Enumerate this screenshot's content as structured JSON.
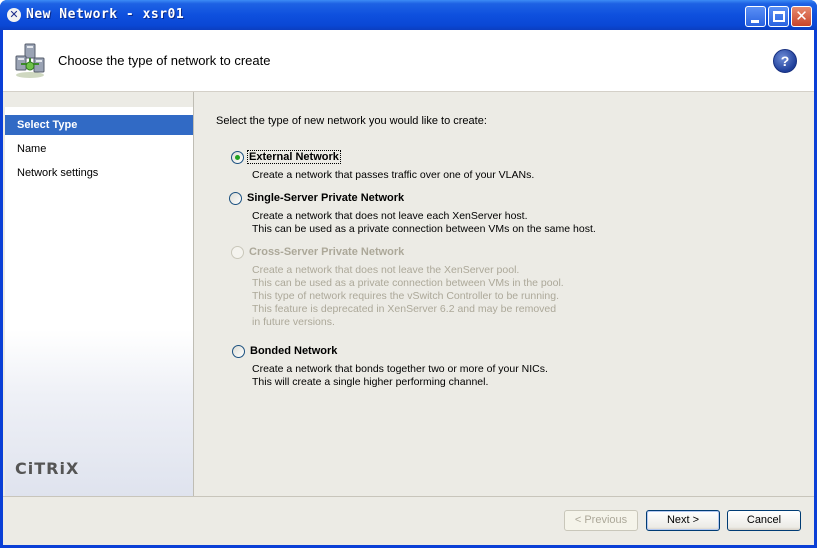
{
  "window": {
    "title": "New Network - xsr01",
    "title_icon": "x-app-icon"
  },
  "header": {
    "title": "Choose the type of network to create",
    "help_glyph": "?"
  },
  "nav": {
    "items": [
      {
        "label": "Select Type",
        "selected": true
      },
      {
        "label": "Name",
        "selected": false
      },
      {
        "label": "Network settings",
        "selected": false
      }
    ],
    "logo": "CiTRiX"
  },
  "main": {
    "prompt": "Select the type of new network you would like to create:",
    "options": [
      {
        "label": "External Network",
        "checked": true,
        "enabled": true,
        "description": [
          "Create a network that passes traffic over one of your VLANs."
        ]
      },
      {
        "label": "Single-Server Private Network",
        "checked": false,
        "enabled": true,
        "description": [
          "Create a network that does not leave each XenServer host.",
          "This can be used as a private connection between VMs on the same host."
        ]
      },
      {
        "label": "Cross-Server Private Network",
        "checked": false,
        "enabled": false,
        "description": [
          "Create a network that does not leave the XenServer pool.",
          "This can be used as a private connection between VMs in the pool.",
          "This type of network requires the vSwitch Controller to be running.",
          "This feature is deprecated in XenServer 6.2 and may be removed",
          "in future versions."
        ]
      },
      {
        "label": "Bonded Network",
        "checked": false,
        "enabled": true,
        "description": [
          "Create a network that bonds together two or more of your NICs.",
          "This will create a single higher performing channel."
        ]
      }
    ]
  },
  "footer": {
    "previous_label": "< Previous",
    "next_label": "Next >",
    "cancel_label": "Cancel"
  },
  "colors": {
    "titlebar": "#0a47d4",
    "selection": "#316ac5",
    "radio_dot": "#21a121"
  }
}
